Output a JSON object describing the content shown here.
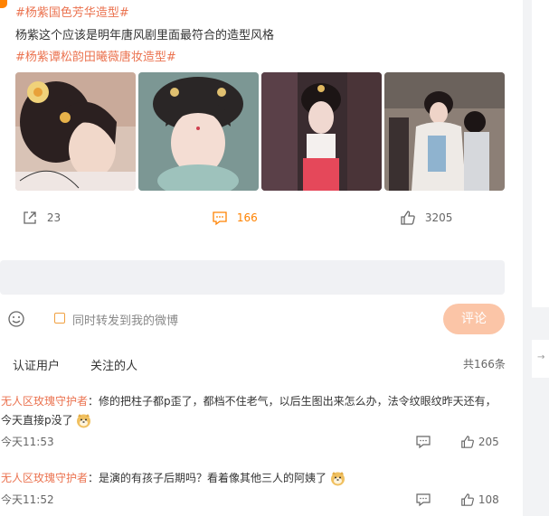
{
  "post": {
    "tag_top": "#杨紫国色芳华造型#",
    "text": "杨紫这个应该是明年唐风剧里面最符合的造型风格",
    "tag_second": "#杨紫谭松韵田曦薇唐妆造型#",
    "photos": [
      {
        "icon": "portrait-photo-1"
      },
      {
        "icon": "portrait-photo-2"
      },
      {
        "icon": "portrait-photo-3"
      },
      {
        "icon": "portrait-photo-4"
      }
    ],
    "reposts": "23",
    "comments": "166",
    "likes": "3205"
  },
  "composer": {
    "repost_checkbox_label": "同时转发到我的微博",
    "submit_label": "评论"
  },
  "filters": {
    "tabs": [
      "认证用户",
      "关注的人"
    ],
    "total": "共166条"
  },
  "comments": [
    {
      "user": "无人区玫瑰守护者",
      "text_line1": "：修的把柱子都p歪了，都档不住老气，以后生图出来怎么办，法令纹眼纹昨天还有，",
      "text_line2": "今天直接p没了",
      "time": "今天11:53",
      "likes": "205"
    },
    {
      "user": "无人区玫瑰守护者",
      "text_line1": "：是演的有孩子后期吗？看着像其他三人的阿姨了",
      "time": "今天11:52",
      "likes": "108"
    }
  ],
  "colors": {
    "accent": "#ff8200",
    "link": "#eb7350",
    "submit_bg": "#fbc5a7"
  }
}
